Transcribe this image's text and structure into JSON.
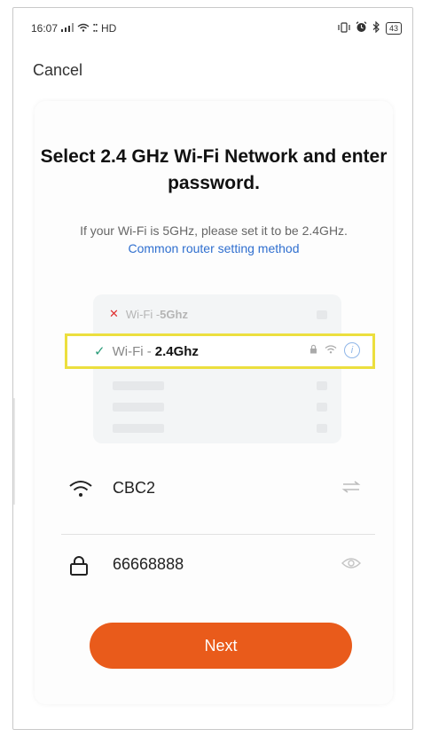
{
  "status_bar": {
    "time": "16:07",
    "network_text": "HD",
    "battery": "43"
  },
  "header": {
    "cancel_label": "Cancel"
  },
  "main": {
    "title": "Select 2.4 GHz Wi-Fi Network and enter password.",
    "subtitle_text": "If your Wi-Fi is 5GHz, please set it to be 2.4GHz.",
    "subtitle_link": "Common router setting method",
    "illustration": {
      "row_5g_prefix": "Wi-Fi - ",
      "row_5g_band": "5Ghz",
      "row_24_prefix": "Wi-Fi - ",
      "row_24_band": "2.4Ghz"
    },
    "ssid_value": "CBC2",
    "password_value": "66668888",
    "next_label": "Next"
  },
  "colors": {
    "accent": "#e95b1b",
    "link": "#2f6fcf",
    "highlight_border": "#ecdf3e",
    "check": "#2b9c7a",
    "cross": "#e03030"
  },
  "icons": [
    "signal-icon",
    "wifi-icon",
    "vibrate-icon",
    "alarm-icon",
    "bluetooth-icon",
    "battery-icon",
    "lock-icon",
    "info-icon",
    "swap-icon",
    "eye-icon"
  ]
}
